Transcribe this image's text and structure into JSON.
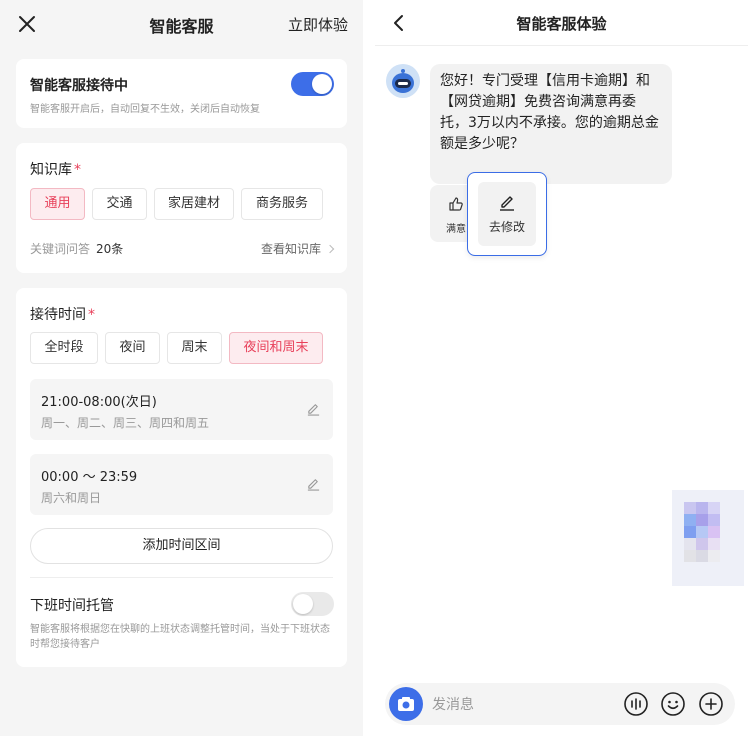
{
  "left": {
    "header": {
      "title": "智能客服",
      "action_label": "立即体验"
    },
    "reception": {
      "title": "智能客服接待中",
      "subtitle": "智能客服开启后，自动回复不生效，关闭后自动恢复",
      "enabled": true
    },
    "knowledge": {
      "title": "知识库",
      "required_mark": "*",
      "chips": [
        "通用",
        "交通",
        "家居建材",
        "商务服务"
      ],
      "selected": "通用",
      "keyword_label": "关键词问答",
      "keyword_count": "20条",
      "view_link": "查看知识库"
    },
    "schedule": {
      "title": "接待时间",
      "required_mark": "*",
      "chips": [
        "全时段",
        "夜间",
        "周末",
        "夜间和周末"
      ],
      "selected": "夜间和周末",
      "ranges": [
        {
          "time": "21:00-08:00(次日)",
          "days": "周一、周二、周三、周四和周五"
        },
        {
          "time": "00:00 ～ 23:59",
          "days": "周六和周日"
        }
      ],
      "add_label": "添加时间区间",
      "offwork_title": "下班时间托管",
      "offwork_enabled": false,
      "offwork_desc": "智能客服将根据您在快聊的上班状态调整托管时间，当处于下班状态时帮您接待客户"
    }
  },
  "right": {
    "header": {
      "title": "智能客服体验"
    },
    "message": "您好！专门受理【信用卡逾期】和【网贷逾期】免费咨询满意再委托，3万以内不承接。您的逾期总金额是多少呢？",
    "feedback_label": "满意",
    "edit_label": "去修改",
    "input_placeholder": "发消息"
  },
  "colors": {
    "accent": "#3d6ee8",
    "chip_selected": "#e8405a",
    "panel_bg": "#f5f5f5"
  },
  "icons": [
    "close-icon",
    "edit-icon",
    "chevron-right-icon",
    "back-icon",
    "robot-avatar",
    "thumbs-up-icon",
    "pen-icon",
    "camera-icon",
    "voice-icon",
    "emoji-icon",
    "plus-icon"
  ]
}
